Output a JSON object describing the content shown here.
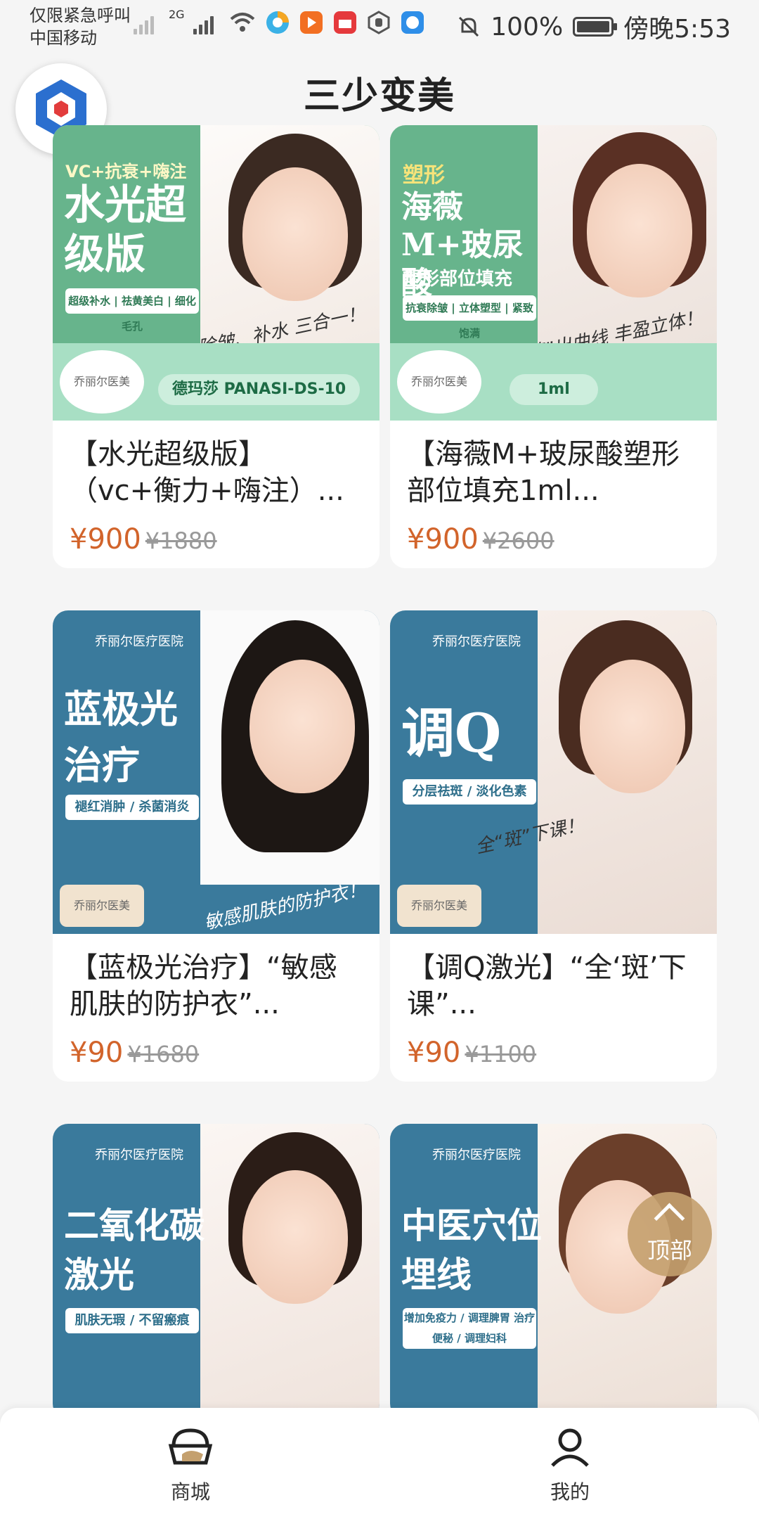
{
  "status_bar": {
    "emergency_text": "仅限紧急呼叫",
    "carrier": "中国移动",
    "network": "2G",
    "battery_percent": "100%",
    "time": "傍晚5:53"
  },
  "header": {
    "title": "三少变美"
  },
  "products": [
    {
      "name": "【水光超级版】（vc+衡力+嗨注）...",
      "price": "¥900",
      "original_price": "¥1880",
      "image": {
        "top_line": "VC+抗衰+嗨注",
        "title": "水光超级版",
        "tag": "超级补水 | 祛黄美白 | 细化毛孔",
        "script": "美白、除皱、补水 三合一！",
        "brand": "乔丽尔医美",
        "pill": "德玛莎 PANASI-DS-10"
      }
    },
    {
      "name": "【海薇M+玻尿酸塑形部位填充1ml...",
      "price": "¥900",
      "original_price": "¥2600",
      "image": {
        "top_line": "塑形",
        "title": "海薇M+玻尿酸",
        "subtitle": "塑形部位填充",
        "tag": "抗衰除皱 | 立体塑型 | 紧致饱满",
        "script": "“填”出曲线 丰盈立体！",
        "brand": "乔丽尔医美",
        "pill": "1ml"
      }
    },
    {
      "name": "【蓝极光治疗】“敏感肌肤的防护衣”...",
      "price": "¥90",
      "original_price": "¥1680",
      "image": {
        "hospital": "乔丽尔医疗医院",
        "title": "蓝极光治疗",
        "tag": "褪红消肿 / 杀菌消炎",
        "script": "敏感肌肤的防护衣！",
        "brand": "乔丽尔医美"
      }
    },
    {
      "name": "【调Q激光】“全‘斑’下课”...",
      "price": "¥90",
      "original_price": "¥1100",
      "image": {
        "hospital": "乔丽尔医疗医院",
        "title": "调Q",
        "tag": "分层祛斑 / 淡化色素",
        "script": "全“斑”下课！",
        "brand": "乔丽尔医美"
      }
    },
    {
      "image": {
        "hospital": "乔丽尔医疗医院",
        "title": "二氧化碳激光",
        "tag": "肌肤无瑕 / 不留瘢痕"
      }
    },
    {
      "image": {
        "hospital": "乔丽尔医疗医院",
        "title": "中医穴位埋线",
        "tag": "增加免疫力 / 调理脾胃 治疗便秘 / 调理妇科"
      }
    }
  ],
  "to_top_button": {
    "label": "顶部"
  },
  "bottom_nav": {
    "items": [
      {
        "label": "商城",
        "icon": "shop-icon"
      },
      {
        "label": "我的",
        "icon": "user-icon"
      }
    ]
  },
  "colors": {
    "price": "#d2642b",
    "green_poster": "#67b48c",
    "blue_poster": "#3a7a9c",
    "to_top": "#c4a06e"
  }
}
